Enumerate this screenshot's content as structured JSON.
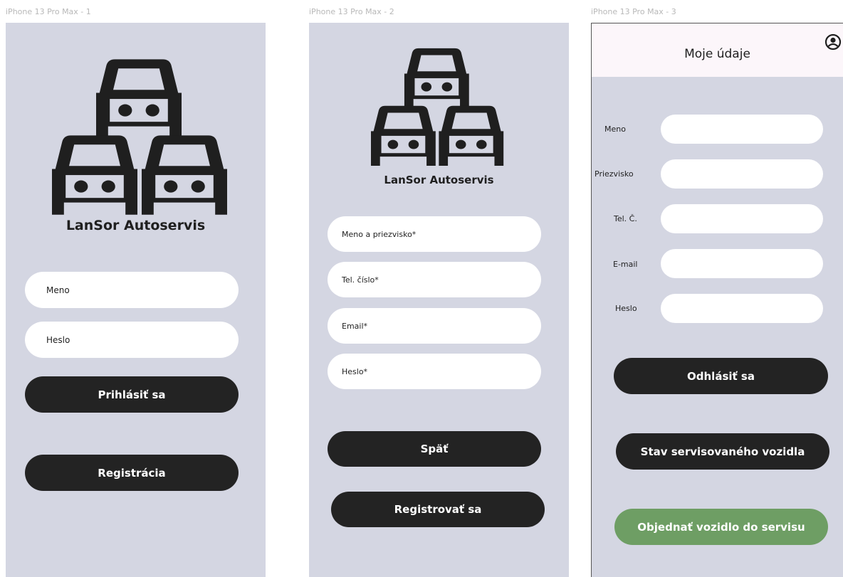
{
  "frames": [
    {
      "label": "iPhone 13 Pro Max - 1"
    },
    {
      "label": "iPhone 13 Pro Max - 2"
    },
    {
      "label": "iPhone 13 Pro Max - 3"
    }
  ],
  "login": {
    "brand": "LanSor Autoservis",
    "name_placeholder": "Meno",
    "password_placeholder": "Heslo",
    "login_button": "Prihlásiť sa",
    "register_button": "Registrácia"
  },
  "register": {
    "brand": "LanSor Autoservis",
    "fullname_placeholder": "Meno a priezvisko*",
    "phone_placeholder": "Tel. číslo*",
    "email_placeholder": "Email*",
    "password_placeholder": "Heslo*",
    "back_button": "Späť",
    "submit_button": "Registrovať sa"
  },
  "profile": {
    "title": "Moje údaje",
    "labels": [
      "Meno",
      "Priezvisko",
      "Tel. Č.",
      "E-mail",
      "Heslo"
    ],
    "logout_button": "Odhlásiť sa",
    "status_button": "Stav servisovaného vozidla",
    "order_button": "Objednať vozidlo do servisu"
  },
  "icons": {
    "logo": "cars-stack-icon",
    "profile": "user-circle-icon"
  },
  "colors": {
    "frame_bg": "#d4d6e2",
    "button_dark": "#232323",
    "button_green": "#6e9e64",
    "header_bg": "#fcf6fa"
  }
}
